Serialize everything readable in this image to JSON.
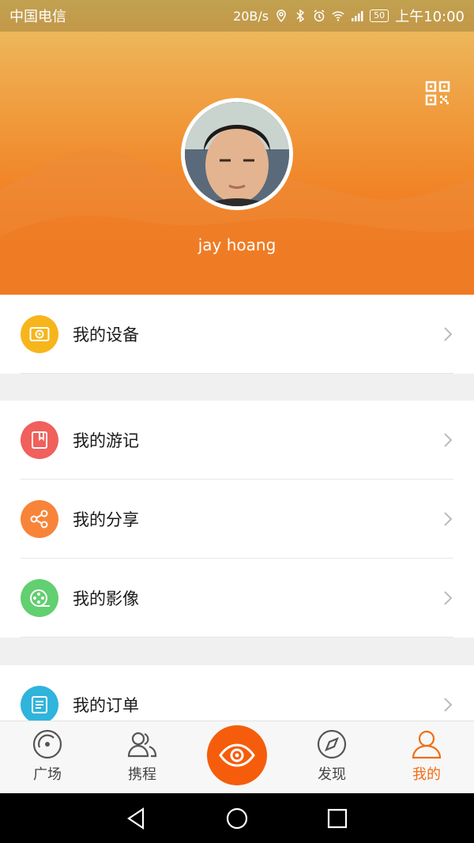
{
  "status_bar": {
    "carrier": "中国电信",
    "net_speed": "20B/s",
    "battery": "50",
    "time": "上午10:00"
  },
  "profile": {
    "username": "jay hoang"
  },
  "menu_sections": [
    [
      {
        "label": "我的设备",
        "icon": "camera-device-icon",
        "color": "#f7b51c"
      }
    ],
    [
      {
        "label": "我的游记",
        "icon": "bookmark-book-icon",
        "color": "#f0605c"
      },
      {
        "label": "我的分享",
        "icon": "share-icon",
        "color": "#f8843a"
      },
      {
        "label": "我的影像",
        "icon": "film-reel-icon",
        "color": "#62cf70"
      }
    ],
    [
      {
        "label": "我的订单",
        "icon": "order-document-icon",
        "color": "#2fb4dc"
      }
    ]
  ],
  "tabs": [
    {
      "label": "广场",
      "icon": "plaza-icon"
    },
    {
      "label": "携程",
      "icon": "companions-icon"
    },
    {
      "label": "",
      "icon": "eye-icon"
    },
    {
      "label": "发现",
      "icon": "compass-icon"
    },
    {
      "label": "我的",
      "icon": "profile-icon"
    }
  ],
  "colors": {
    "accent": "#f26c14",
    "eye_button": "#f55d0c"
  }
}
